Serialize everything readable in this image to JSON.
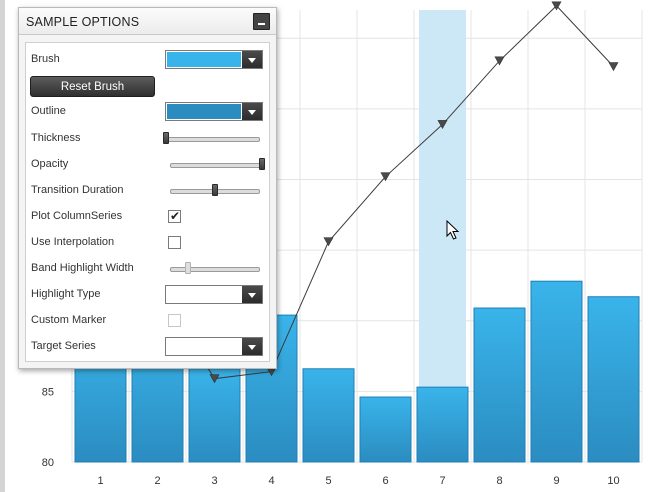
{
  "panel": {
    "title": "SAMPLE OPTIONS",
    "brush": {
      "label": "Brush",
      "color": "#39b4ea"
    },
    "reset_button_label": "Reset Brush",
    "outline": {
      "label": "Outline",
      "color": "#2b8cc0"
    },
    "thickness": {
      "label": "Thickness",
      "value": 0.0
    },
    "opacity": {
      "label": "Opacity",
      "value": 1.0
    },
    "transition_duration": {
      "label": "Transition Duration",
      "value": 0.5
    },
    "plot_column_series": {
      "label": "Plot ColumnSeries",
      "checked": true
    },
    "use_interpolation": {
      "label": "Use Interpolation",
      "checked": false
    },
    "band_highlight_width": {
      "label": "Band Highlight Width",
      "value": 0.2,
      "enabled": false
    },
    "highlight_type": {
      "label": "Highlight Type",
      "value": ""
    },
    "custom_marker": {
      "label": "Custom Marker",
      "checked": false,
      "enabled": false
    },
    "target_series": {
      "label": "Target Series",
      "value": ""
    }
  },
  "chart_data": {
    "type": "bar",
    "categories": [
      "1",
      "2",
      "3",
      "4",
      "5",
      "6",
      "7",
      "8",
      "9",
      "10"
    ],
    "series": [
      {
        "type": "bar",
        "values": [
          89.5,
          89.6,
          86.6,
          90.4,
          86.6,
          84.6,
          85.3,
          90.9,
          92.8,
          91.7
        ]
      },
      {
        "type": "line",
        "values": [
          92.9,
          92.4,
          85.9,
          86.4,
          95.6,
          100.2,
          103.9,
          108.4,
          112.3,
          108.0
        ]
      }
    ],
    "y_ticks": [
      "80",
      "85"
    ],
    "ylim": [
      80,
      112
    ],
    "highlight_category": "7",
    "grid": true,
    "bar_color": "#39b4ea",
    "bar_color_dark": "#2b8cc0",
    "line_color": "#3b3b3b",
    "band_color": "#cce8f6"
  }
}
